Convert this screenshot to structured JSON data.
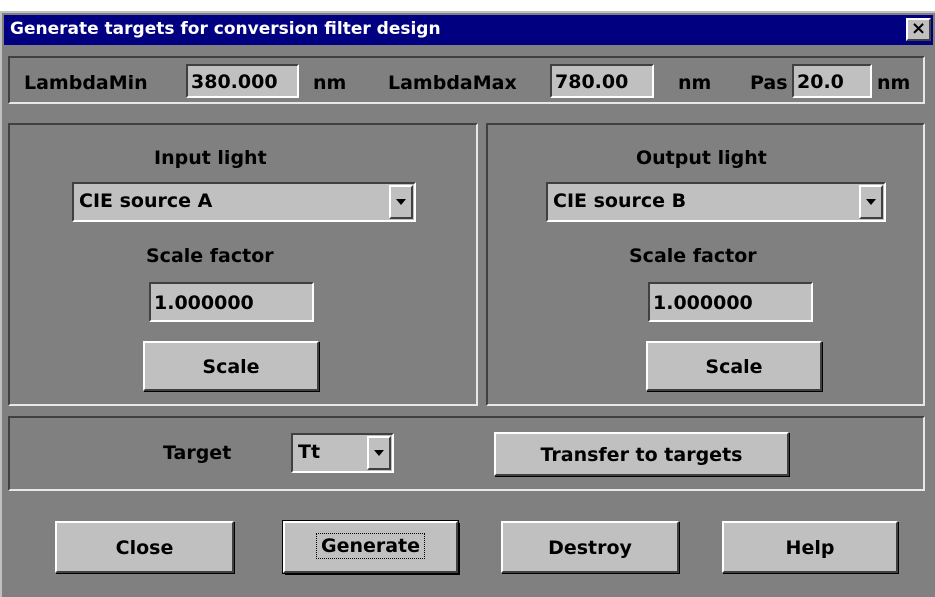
{
  "window": {
    "title": "Generate targets for conversion filter design",
    "close_glyph": "×"
  },
  "range": {
    "lambda_min_label": "LambdaMin",
    "lambda_min_value": "380.000",
    "lambda_min_unit": "nm",
    "lambda_max_label": "LambdaMax",
    "lambda_max_value": "780.00",
    "lambda_max_unit": "nm",
    "pas_label": "Pas",
    "pas_value": "20.0",
    "pas_unit": "nm"
  },
  "input_light": {
    "heading": "Input light",
    "source": "CIE source A",
    "scale_label": "Scale factor",
    "scale_value": "1.000000",
    "scale_button": "Scale"
  },
  "output_light": {
    "heading": "Output light",
    "source": "CIE source B",
    "scale_label": "Scale factor",
    "scale_value": "1.000000",
    "scale_button": "Scale"
  },
  "target": {
    "label": "Target",
    "value": "Tt",
    "transfer_button": "Transfer to  targets"
  },
  "buttons": {
    "close": "Close",
    "generate": "Generate",
    "destroy": "Destroy",
    "help": "Help"
  },
  "colors": {
    "titlebar": "#000080",
    "dialog_bg": "#808080",
    "control_bg": "#c0c0c0"
  },
  "icons": {
    "dropdown": "chevron-down-icon",
    "close": "close-icon"
  }
}
